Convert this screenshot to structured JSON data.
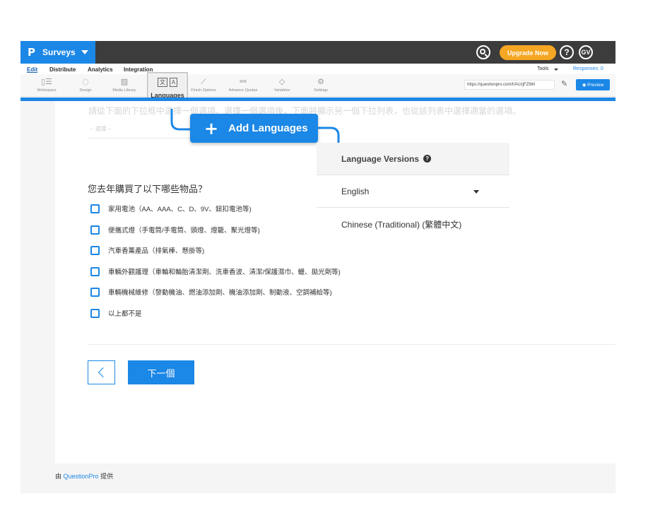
{
  "colors": {
    "brand": "#1b87e6",
    "topbar": "#3c3c3c",
    "upgrade": "#f5a623"
  },
  "header": {
    "logo": "P",
    "app_title": "Surveys",
    "upgrade_label": "Upgrade Now",
    "help_label": "?",
    "avatar_initials": "GV"
  },
  "menu": {
    "edit": "Edit",
    "distribute": "Distribute",
    "analytics": "Analytics",
    "integration": "Integration",
    "tools": "Tools",
    "responses": "Responses: 0"
  },
  "toolbar": {
    "workspace": "Workspace",
    "design": "Design",
    "media_library": "Media Library",
    "languages": "Languages",
    "finish_options": "Finish Options",
    "advance_quotas": "Advance Quotas",
    "variables": "Variables",
    "settings": "Settings",
    "survey_url": "https://questionpro.com/t/AUzjFZtWi",
    "preview_label": "Preview"
  },
  "survey": {
    "instruction": "請從下面的下拉框中選擇一個選項。選擇一個選項後，下面將顯示另一個下拉列表，也從該列表中選擇適當的選項。",
    "select_placeholder": "-- 選擇 --",
    "question": "您去年購買了以下哪些物品？",
    "options": [
      "家用電池（AA、AAA、C、D、9V、鈕扣電池等)",
      "便攜式燈（手電筒/手電筒、頭燈、燈籠、聚光燈等)",
      "汽車香薰產品（排氣棒、懸掛等)",
      "車輛外觀護理（車輪和輪胎清潔劑、洗車香波、清潔/保護濕巾、蠟、拋光劑等)",
      "車輛機械維修（發動機油、燃油添加劑、機油添加劑、制動液、空調補給等)",
      "以上都不是"
    ],
    "next_label": "下一個"
  },
  "footer": {
    "prefix": "由",
    "brand": "QuestionPro",
    "suffix": "提供"
  },
  "callout": {
    "add_languages": "Add Languages"
  },
  "language_panel": {
    "title": "Language Versions",
    "selected": "English",
    "item": "Chinese (Traditional) (繁體中文)"
  }
}
